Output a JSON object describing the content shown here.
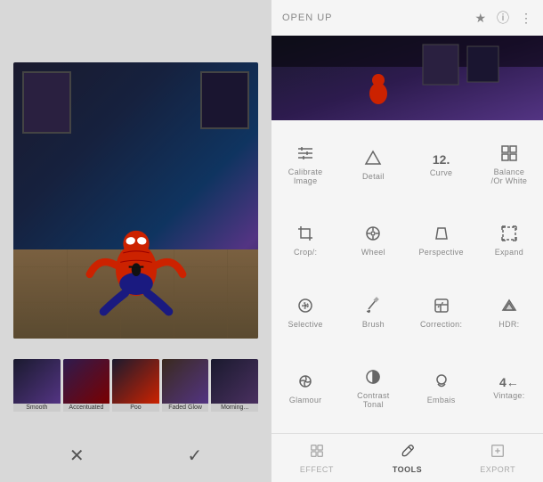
{
  "left": {
    "filmstrip": [
      {
        "label": "Smooth"
      },
      {
        "label": "Accentuated"
      },
      {
        "label": "Poo"
      },
      {
        "label": "Faded Glow"
      },
      {
        "label": "Morning..."
      }
    ],
    "cancel_label": "✕",
    "confirm_label": "✓"
  },
  "right": {
    "header": {
      "title": "OPEN UP",
      "icons": [
        "wifi",
        "info",
        "menu"
      ]
    },
    "tools": [
      {
        "id": "calibrate",
        "label": "Calibrate\nImage",
        "icon": "sliders"
      },
      {
        "id": "detail",
        "label": "Detail",
        "icon": "triangle"
      },
      {
        "id": "curve",
        "label": "Curve",
        "icon": "12"
      },
      {
        "id": "balance",
        "label": "Balance\n/Or White",
        "icon": "balance"
      },
      {
        "id": "crop",
        "label": "Crop/:",
        "icon": "crop"
      },
      {
        "id": "wheel",
        "label": "Wheel",
        "icon": "wheel"
      },
      {
        "id": "perspective",
        "label": "Perspective",
        "icon": "perspective"
      },
      {
        "id": "expand",
        "label": "Expand",
        "icon": "expand"
      },
      {
        "id": "selective",
        "label": "Selective",
        "icon": "selective"
      },
      {
        "id": "brush",
        "label": "Brush",
        "icon": "brush"
      },
      {
        "id": "correction",
        "label": "Correction:",
        "icon": "correction"
      },
      {
        "id": "hdr",
        "label": "HDR:",
        "icon": "hdr"
      },
      {
        "id": "glamour",
        "label": "Glamour",
        "icon": "glamour"
      },
      {
        "id": "contrast",
        "label": "Contrast\nTonal",
        "icon": "contrast"
      },
      {
        "id": "embais",
        "label": "Embais",
        "icon": "embais"
      },
      {
        "id": "vintage",
        "label": "Vintage:",
        "icon": "vintage"
      }
    ],
    "bottom_nav": [
      {
        "id": "effect",
        "label": "EFFECT",
        "icon": "effect"
      },
      {
        "id": "tools",
        "label": "TOOLS",
        "icon": "tools",
        "active": true
      },
      {
        "id": "export",
        "label": "EXPORT",
        "icon": "export"
      }
    ]
  }
}
